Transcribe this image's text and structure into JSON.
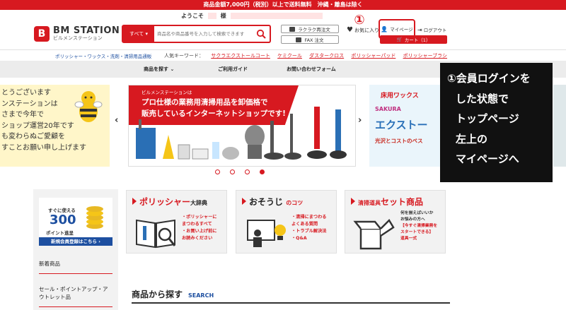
{
  "topbar": {
    "text": "商品金額7,000円（税別）以上で送料無料　沖縄・離島は除く"
  },
  "header": {
    "welcome": "ようこそ",
    "honorific": "様",
    "logo_mark": "B",
    "logo_main": "BM STATION",
    "logo_sub": "ビルメンステーション",
    "search": {
      "category": "すべて",
      "placeholder": "商品名や商品番号を入力して検索できます"
    },
    "quick_order": "ラクラク再注文",
    "fax_order": "FAX 注文",
    "favorites": "お気に入り",
    "step_number": "①",
    "mypage": "マイページ",
    "logout": "ログアウト",
    "cart": "カート（1）"
  },
  "subnav": {
    "tagline": "ポリッシャー・ワックス・洗剤・清掃用品通販",
    "keywords_label": "人気キーワード：",
    "keywords": [
      "サクラエクストールコート",
      "ケミクール",
      "ダスタークロス",
      "ポリッシャーパッド",
      "ポリッシャーブラシ"
    ]
  },
  "mainnav": {
    "items": [
      "商品を探す",
      "ご利用ガイド",
      "お問い合わせフォーム"
    ]
  },
  "carousel": {
    "left_banner": [
      "とうございます",
      "ンステーションは",
      "さまで今年で",
      "ショップ運営20年です",
      "も変わらぬご愛顧を",
      "すことお願い申し上げます"
    ],
    "main_small": "ビルメンステーションは",
    "main_line1": "プロ仕様の業務用清掃用品を卸価格で",
    "main_line2": "販売しているインターネットショップです!",
    "right_t1": "床用ワックス",
    "right_t2": "SAKURA",
    "right_t3": "エクストー",
    "right_t4": "光沢とコストのベス",
    "prev": "‹",
    "next": "›"
  },
  "callout": {
    "lines": [
      "①会員ログインを",
      "した状態で",
      "トップページ",
      "左上の",
      "マイページへ"
    ]
  },
  "sidebar": {
    "point_l1": "すぐに使える",
    "point_big": "300",
    "point_l3": "ポイント進呈",
    "register": "新規会員登録はこちら ›",
    "items": [
      "新着商品",
      "セール・ポイントアップ・アウトレット品"
    ]
  },
  "cards": [
    {
      "title_red": "ポリッシャー",
      "title_rest": "大辞典",
      "lines": [
        "・ポリッシャーに",
        "  まつわるすべて",
        "・お買い上げ前に",
        "  お読みください"
      ]
    },
    {
      "title_red": "おそうじ",
      "title_rest": "のコツ",
      "lines": [
        "・清掃にまつわる",
        "  よくある質問",
        "・トラブル解決法",
        "・Q&A"
      ]
    },
    {
      "title_red": "清掃道具",
      "title_rest": "セット商品",
      "lines": [
        "何を揃えばいいか",
        "お悩みの方へ",
        "【今すぐ清掃業務を",
        "スタートできる】",
        "道具一式"
      ]
    }
  ],
  "section": {
    "title": "商品から探す",
    "en": "SEARCH"
  },
  "colors": {
    "brand_red": "#d71920",
    "navy": "#1d4fa0"
  }
}
